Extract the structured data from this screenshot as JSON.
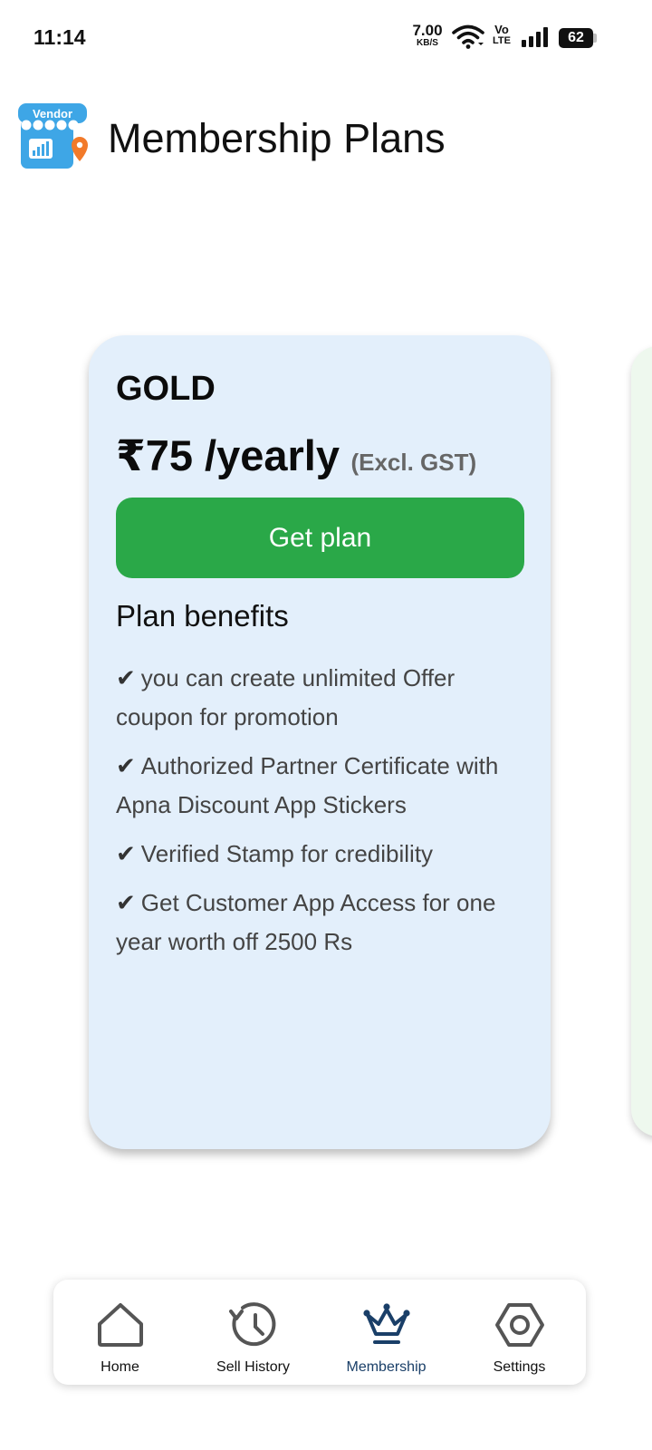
{
  "status_bar": {
    "time": "11:14",
    "net_speed_value": "7.00",
    "net_speed_unit": "KB/S",
    "volte_top": "Vo",
    "volte_bottom": "LTE",
    "battery": "62"
  },
  "header": {
    "logo_text": "Vendor",
    "title": "Membership Plans"
  },
  "plan": {
    "name": "GOLD",
    "price": "₹75 /yearly",
    "tax_note": "(Excl. GST)",
    "cta_label": "Get plan",
    "benefits_title": "Plan benefits",
    "check_glyph": "✔",
    "benefits": [
      "you can create unlimited Offer coupon for promotion",
      "Authorized Partner Certificate with Apna Discount App Stickers",
      "Verified Stamp for credibility",
      "Get Customer App Access for one year worth off 2500 Rs"
    ],
    "card_color": "#e3effb",
    "cta_color": "#2aa848"
  },
  "bottom_nav": {
    "items": [
      {
        "label": "Home",
        "icon": "home-icon"
      },
      {
        "label": "Sell History",
        "icon": "history-icon"
      },
      {
        "label": "Membership",
        "icon": "crown-icon",
        "active": true
      },
      {
        "label": "Settings",
        "icon": "settings-icon"
      }
    ],
    "active_color": "#1a3f68"
  }
}
